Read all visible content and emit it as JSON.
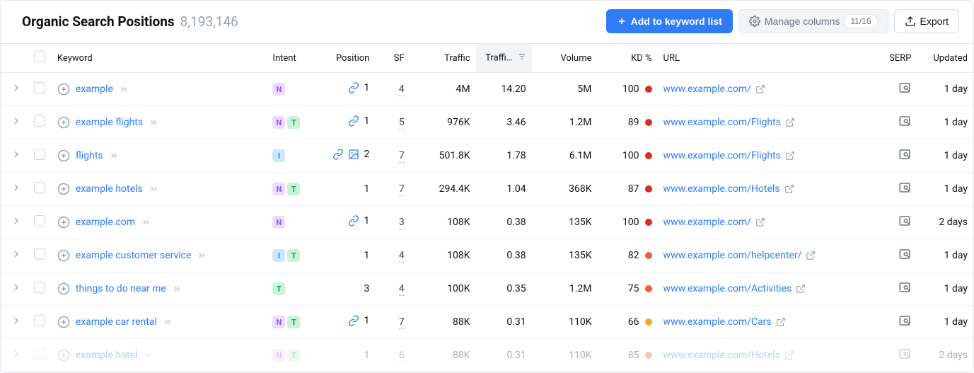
{
  "header": {
    "title": "Organic Search Positions",
    "count": "8,193,146",
    "add_label": "Add to keyword list",
    "manage_label": "Manage columns",
    "manage_count": "11/16",
    "export_label": "Export"
  },
  "columns": {
    "keyword": "Keyword",
    "intent": "Intent",
    "position": "Position",
    "sf": "SF",
    "traffic": "Traffic",
    "traffic_share": "Traffi…",
    "volume": "Volume",
    "kd": "KD %",
    "url": "URL",
    "serp": "SERP",
    "updated": "Updated"
  },
  "rows": [
    {
      "keyword": "example",
      "intents": [
        "N"
      ],
      "pos_icons": [
        "link"
      ],
      "position": "1",
      "sf": "4",
      "traffic": "4M",
      "traffic_share": "14.20",
      "volume": "5M",
      "kd": "100",
      "kd_color": "#d92d20",
      "url": "www.example.com/",
      "updated": "1 day"
    },
    {
      "keyword": "example flights",
      "intents": [
        "N",
        "T"
      ],
      "pos_icons": [
        "link"
      ],
      "position": "1",
      "sf": "5",
      "traffic": "976K",
      "traffic_share": "3.46",
      "volume": "1.2M",
      "kd": "89",
      "kd_color": "#d92d20",
      "url": "www.example.com/Flights",
      "updated": "1 day"
    },
    {
      "keyword": "flights",
      "intents": [
        "I"
      ],
      "pos_icons": [
        "link",
        "image"
      ],
      "position": "2",
      "sf": "7",
      "traffic": "501.8K",
      "traffic_share": "1.78",
      "volume": "6.1M",
      "kd": "100",
      "kd_color": "#d92d20",
      "url": "www.example.com/Flights",
      "updated": "1 day"
    },
    {
      "keyword": "example hotels",
      "intents": [
        "N",
        "T"
      ],
      "pos_icons": [],
      "position": "1",
      "sf": "7",
      "traffic": "294.4K",
      "traffic_share": "1.04",
      "volume": "368K",
      "kd": "87",
      "kd_color": "#d92d20",
      "url": "www.example.com/Hotels",
      "updated": "1 day"
    },
    {
      "keyword": "example.com",
      "intents": [
        "N"
      ],
      "pos_icons": [
        "link"
      ],
      "position": "1",
      "sf": "3",
      "traffic": "108K",
      "traffic_share": "0.38",
      "volume": "135K",
      "kd": "100",
      "kd_color": "#d92d20",
      "url": "www.example.com/",
      "updated": "2 days"
    },
    {
      "keyword": "example customer service",
      "intents": [
        "I",
        "T"
      ],
      "pos_icons": [],
      "position": "1",
      "sf": "4",
      "traffic": "108K",
      "traffic_share": "0.38",
      "volume": "135K",
      "kd": "82",
      "kd_color": "#f25c3b",
      "url": "www.example.com/helpcenter/",
      "updated": "1 day"
    },
    {
      "keyword": "things to do near me",
      "intents": [
        "T"
      ],
      "pos_icons": [],
      "position": "3",
      "sf": "4",
      "traffic": "100K",
      "traffic_share": "0.35",
      "volume": "1.2M",
      "kd": "75",
      "kd_color": "#f25c3b",
      "url": "www.example.com/Activities",
      "updated": "1 day"
    },
    {
      "keyword": "example car rental",
      "intents": [
        "N",
        "T"
      ],
      "pos_icons": [
        "link"
      ],
      "position": "1",
      "sf": "7",
      "traffic": "88K",
      "traffic_share": "0.31",
      "volume": "110K",
      "kd": "66",
      "kd_color": "#f5a623",
      "url": "www.example.com/Cars",
      "updated": "1 day"
    },
    {
      "keyword": "example hotel",
      "intents": [
        "N",
        "T"
      ],
      "pos_icons": [],
      "position": "1",
      "sf": "6",
      "traffic": "88K",
      "traffic_share": "0.31",
      "volume": "110K",
      "kd": "85",
      "kd_color": "#f25c3b",
      "url": "www.example.com/Hotels",
      "updated": "2 days",
      "faded": true
    }
  ]
}
